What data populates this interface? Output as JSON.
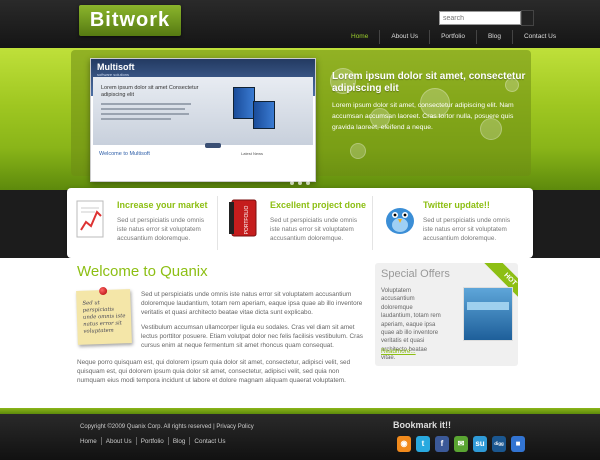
{
  "header": {
    "logo": "Bitwork",
    "search_placeholder": "search",
    "nav": [
      "Home",
      "About Us",
      "Portfolio",
      "Blog",
      "Contact Us"
    ],
    "active_nav": "Home"
  },
  "hero": {
    "screenshot": {
      "logo": "Multisoft",
      "tagline": "software solutions",
      "banner_title": "Lorem ipsum dolor sit amet Consectetur adipiscing elit",
      "welcome": "Welcome to Multisoft",
      "news": "Latest News"
    },
    "title": "Lorem ipsum dolor sit amet, consectetur adipiscing elit",
    "text": "Lorem ipsum dolor sit amet, consectetur adipiscing elit. Nam accumsan accumsan laoreet. Cras tortor nulla, posuere quis gravida laoreet, eleifend a neque."
  },
  "features": [
    {
      "title": "Increase your market",
      "text": "Sed ut perspiciatis unde omnis iste natus error sit voluptatem accusantium doloremque.",
      "icon": "chart-document-icon"
    },
    {
      "title": "Excellent project done",
      "text": "Sed ut perspiciatis unde omnis iste natus error sit voluptatem accusantium doloremque.",
      "icon": "portfolio-binder-icon"
    },
    {
      "title": "Twitter update!!",
      "text": "Sed ut perspiciatis unde omnis iste natus error sit voluptatem accusantium doloremque.",
      "icon": "twitter-bird-icon"
    }
  ],
  "main": {
    "welcome_title": "Welcome to Quanix",
    "note_text": "Sed ut perspiciatis unde omnis iste natus error sit voluptatem",
    "para1": "Sed ut perspiciatis unde omnis iste natus error sit voluptatem accusantium doloremque laudantium, totam rem aperiam, eaque ipsa quae ab illo inventore veritatis et quasi architecto beatae vitae dicta sunt explicabo.",
    "para2": "Vestibulum accumsan ullamcorper ligula eu sodales. Cras vel diam sit amet lectus porttitor posuere. Etiam volutpat dolor nec felis facilisis vestibulum. Cras cursus enim at neque fermentum sit amet rhoncus quam consequat.",
    "para3": "Neque porro quisquam est, qui dolorem ipsum quia dolor sit amet, consectetur, adipisci velit, sed quisquam est, qui dolorem ipsum quia dolor sit amet, consectetur, adipisci velit, sed quia non numquam eius modi tempora incidunt ut labore et dolore magnam aliquam quaerat voluptatem."
  },
  "offers": {
    "title": "Special Offers",
    "badge": "HOT",
    "text": "Voluptatem accusantium doloremque laudantium, totam rem aperiam, eaque ipsa quae ab illo inventore veritatis et quasi architecto beatae vitae.",
    "link": "Readmore..."
  },
  "footer": {
    "copyright": "Copyright ©2009 Quanix Corp. All rights reserved | Privacy Policy",
    "nav": [
      "Home",
      "About Us",
      "Portfolio",
      "Blog",
      "Contact Us"
    ],
    "bookmark_title": "Bookmark it!!",
    "social": [
      {
        "name": "rss-icon",
        "glyph": "◉",
        "color": "#f18a1c"
      },
      {
        "name": "twitter-icon",
        "glyph": "t",
        "color": "#29a9df"
      },
      {
        "name": "facebook-icon",
        "glyph": "f",
        "color": "#3b5998"
      },
      {
        "name": "chat-icon",
        "glyph": "✉",
        "color": "#5aa532"
      },
      {
        "name": "stumbleupon-icon",
        "glyph": "su",
        "color": "#2f9ad6"
      },
      {
        "name": "digg-icon",
        "glyph": "digg",
        "color": "#1b5790"
      },
      {
        "name": "delicious-icon",
        "glyph": "■",
        "color": "#3274d2"
      }
    ]
  }
}
